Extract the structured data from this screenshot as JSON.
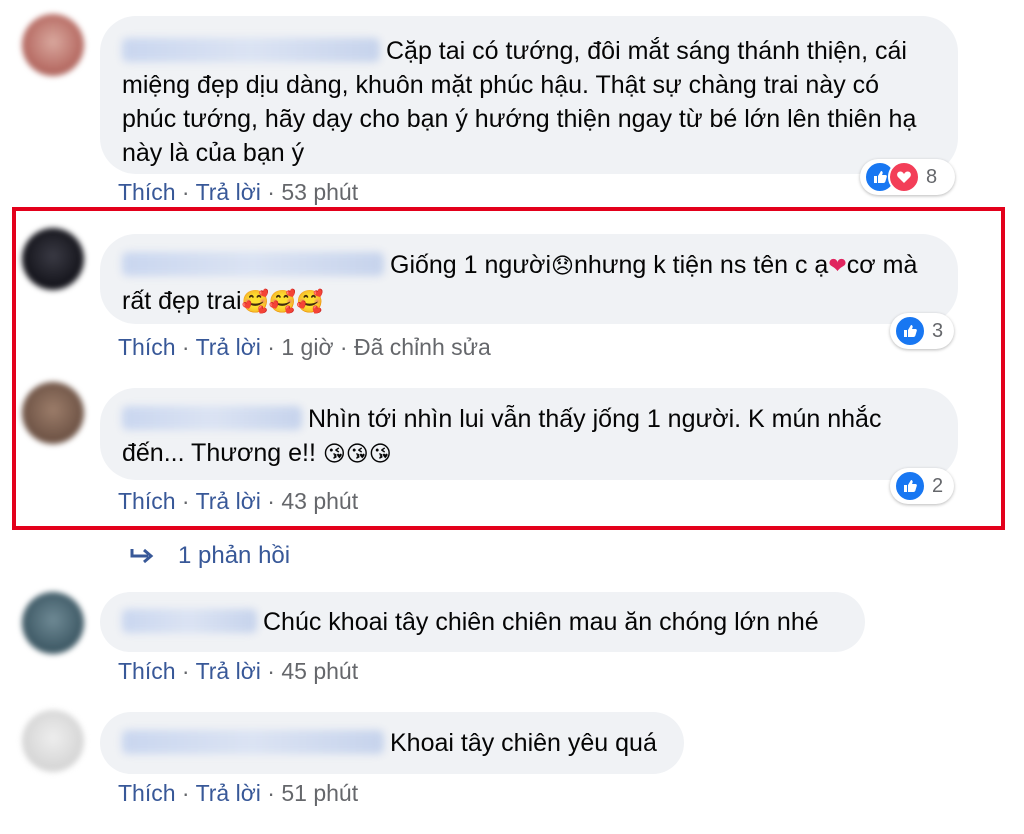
{
  "comments": [
    {
      "text": "Cặp tai có tướng, đôi mắt sáng thánh thiện, cái miệng đẹp dịu dàng, khuôn mặt phúc hậu. Thật sự chàng trai này có phúc tướng, hãy dạy cho bạn ý hướng thiện ngay từ bé lớn lên thiên hạ này là của bạn ý",
      "like": "Thích",
      "reply": "Trả lời",
      "time": "53 phút",
      "reaction_count": "8"
    },
    {
      "text_parts": [
        "Giống 1 người",
        "nhưng k tiện ns tên c ạ",
        "cơ mà rất đẹp trai"
      ],
      "emojis": [
        "😞",
        "❤",
        "🥰🥰🥰"
      ],
      "like": "Thích",
      "reply": "Trả lời",
      "time": "1 giờ",
      "edited": "Đã chỉnh sửa",
      "reaction_count": "3"
    },
    {
      "text": "Nhìn tới nhìn lui vẫn thấy jống 1 người. K mún nhắc đến... Thương e!!",
      "emojis": "😘😘😘",
      "like": "Thích",
      "reply": "Trả lời",
      "time": "43 phút",
      "reaction_count": "2"
    },
    {
      "text": "Chúc khoai tây chiên chiên mau ăn chóng lớn nhé",
      "like": "Thích",
      "reply": "Trả lời",
      "time": "45 phút"
    },
    {
      "text": "Khoai tây chiên yêu quá",
      "like": "Thích",
      "reply": "Trả lời",
      "time": "51 phút"
    }
  ],
  "replies_link": "1 phản hồi",
  "separator": " · ",
  "icons": {
    "like": "like-icon",
    "love": "love-icon",
    "reply_arrow": "reply-arrow-icon"
  },
  "colors": {
    "bubble": "#f0f2f5",
    "link": "#385898",
    "highlight": "#e3001b",
    "like": "#1877f2",
    "love": "#f33e58"
  }
}
